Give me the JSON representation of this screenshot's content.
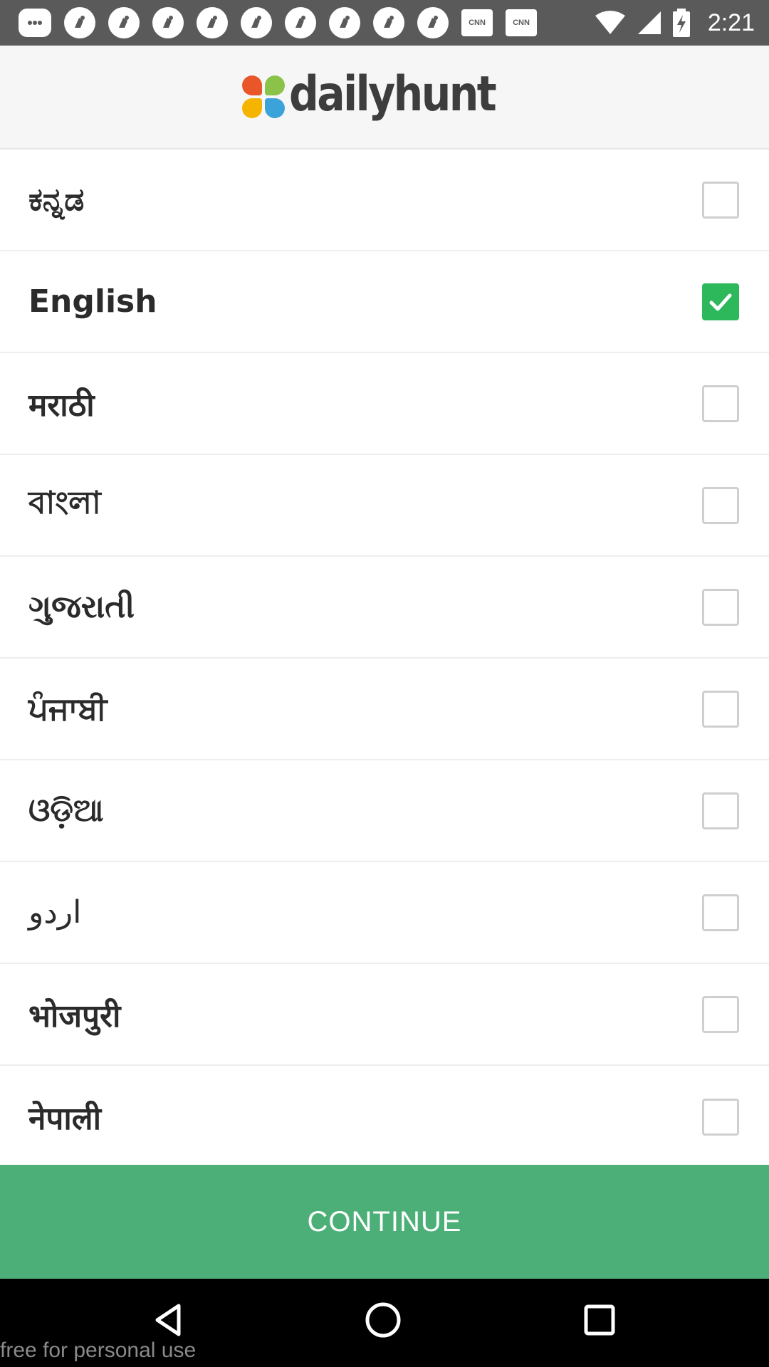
{
  "status_bar": {
    "time": "2:21",
    "notification_icons": [
      "message-icon",
      "app-icon",
      "app-icon",
      "app-icon",
      "app-icon",
      "app-icon",
      "app-icon",
      "app-icon",
      "app-icon",
      "app-icon",
      "cnn-icon",
      "cnn-icon"
    ],
    "cnn_label": "CNN"
  },
  "header": {
    "logo_text": "dailyhunt",
    "logo_colors": [
      "#e8562a",
      "#8bc34a",
      "#f5b400",
      "#3ba3d9"
    ]
  },
  "languages": [
    {
      "label": "ಕನ್ನಡ",
      "checked": false
    },
    {
      "label": "English",
      "checked": true
    },
    {
      "label": "मराठी",
      "checked": false
    },
    {
      "label": "বাংলা",
      "checked": false
    },
    {
      "label": "ગુજરાતી",
      "checked": false
    },
    {
      "label": "ਪੰਜਾਬੀ",
      "checked": false
    },
    {
      "label": "ଓଡ଼ିଆ",
      "checked": false
    },
    {
      "label": "اردو",
      "checked": false
    },
    {
      "label": "भोजपुरी",
      "checked": false
    },
    {
      "label": "नेपाली",
      "checked": false
    }
  ],
  "continue_label": "CONTINUE",
  "colors": {
    "accent": "#4daf78",
    "checked": "#2eb85c"
  },
  "watermark": "free for personal use"
}
